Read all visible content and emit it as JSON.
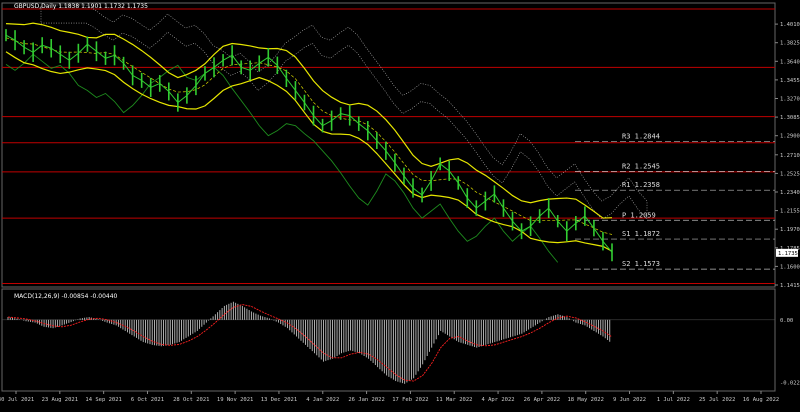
{
  "header": {
    "symbol_info": "GBPUSD,Daily  1.1838 1.1901 1.1732 1.1735",
    "macd_info": "MACD(12,26,9) -0.00854 -0.00440"
  },
  "colors": {
    "background": "#000000",
    "price_line": "#32cd32",
    "bollinger": "#e6e600",
    "level_line": "#c00000",
    "ichimoku_cloud": "#bcbcbc",
    "chikou": "#1e8c1e",
    "macd_hist": "#c0c0c0",
    "macd_signal": "#ff2020"
  },
  "levels": [
    {
      "label": "R3",
      "value": "1.2844"
    },
    {
      "label": "R2",
      "value": "1.2545"
    },
    {
      "label": "R1",
      "value": "1.2358"
    },
    {
      "label": "P",
      "value": "1.2059"
    },
    {
      "label": "S1",
      "value": "1.1872"
    },
    {
      "label": "S2",
      "value": "1.1573"
    }
  ],
  "current_price": "1.1735",
  "chart_data": [
    {
      "type": "line",
      "name_pane": "price",
      "title": "GBPUSD,Daily",
      "ylim": [
        1.1415,
        1.42
      ],
      "y_ticks": [
        "1.4010",
        "1.3825",
        "1.3640",
        "1.3455",
        "1.3270",
        "1.3085",
        "1.2900",
        "1.2710",
        "1.2525",
        "1.2340",
        "1.2155",
        "1.1970",
        "1.1785",
        "1.1600",
        "1.1415"
      ],
      "x_ticks": [
        "30 Jul 2021",
        "23 Aug 2021",
        "14 Sep 2021",
        "6 Oct 2021",
        "28 Oct 2021",
        "19 Nov 2021",
        "13 Dec 2021",
        "4 Jan 2022",
        "26 Jan 2022",
        "17 Feb 2022",
        "11 Mar 2022",
        "4 Apr 2022",
        "26 Apr 2022",
        "18 May 2022",
        "9 Jun 2022",
        "1 Jul 2022",
        "25 Jul 2022",
        "16 Aug 2022"
      ],
      "series": [
        {
          "values": [
            1.39,
            1.385,
            1.378,
            1.373,
            1.38,
            1.377,
            1.371,
            1.365,
            1.372,
            1.381,
            1.374,
            1.367,
            1.37,
            1.362,
            1.35,
            1.345,
            1.338,
            1.342,
            1.334,
            1.323,
            1.33,
            1.34,
            1.352,
            1.358,
            1.365,
            1.37,
            1.358,
            1.355,
            1.362,
            1.368,
            1.36,
            1.347,
            1.335,
            1.323,
            1.31,
            1.3,
            1.305,
            1.312,
            1.31,
            1.302,
            1.295,
            1.285,
            1.275,
            1.263,
            1.25,
            1.238,
            1.231,
            1.245,
            1.262,
            1.255,
            1.243,
            1.228,
            1.218,
            1.225,
            1.232,
            1.218,
            1.205,
            1.195,
            1.2,
            1.21,
            1.218,
            1.205,
            1.195,
            1.203,
            1.21,
            1.198,
            1.185,
            1.174
          ]
        }
      ]
    },
    {
      "type": "bar",
      "name_pane": "macd",
      "title": "MACD(12,26,9)",
      "ylim": [
        -0.0245,
        0.01
      ],
      "y_ticks": [
        "0.00",
        "-0.02245"
      ],
      "series": [
        {
          "values": [
            0.001,
            0.0004,
            -0.0005,
            -0.001,
            -0.0025,
            -0.003,
            -0.002,
            -0.0008,
            0.0005,
            0.001,
            0.0002,
            -0.001,
            -0.002,
            -0.004,
            -0.006,
            -0.008,
            -0.009,
            -0.0095,
            -0.009,
            -0.008,
            -0.006,
            -0.004,
            -0.001,
            0.002,
            0.005,
            0.0065,
            0.005,
            0.003,
            0.0015,
            0.0005,
            -0.001,
            -0.003,
            -0.006,
            -0.009,
            -0.012,
            -0.015,
            -0.014,
            -0.012,
            -0.011,
            -0.012,
            -0.014,
            -0.017,
            -0.02,
            -0.022,
            -0.023,
            -0.021,
            -0.016,
            -0.01,
            -0.004,
            -0.006,
            -0.008,
            -0.009,
            -0.01,
            -0.009,
            -0.008,
            -0.007,
            -0.006,
            -0.005,
            -0.003,
            -0.001,
            0.001,
            0.002,
            0.001,
            -0.001,
            -0.002,
            -0.004,
            -0.006,
            -0.0085
          ]
        }
      ]
    }
  ]
}
